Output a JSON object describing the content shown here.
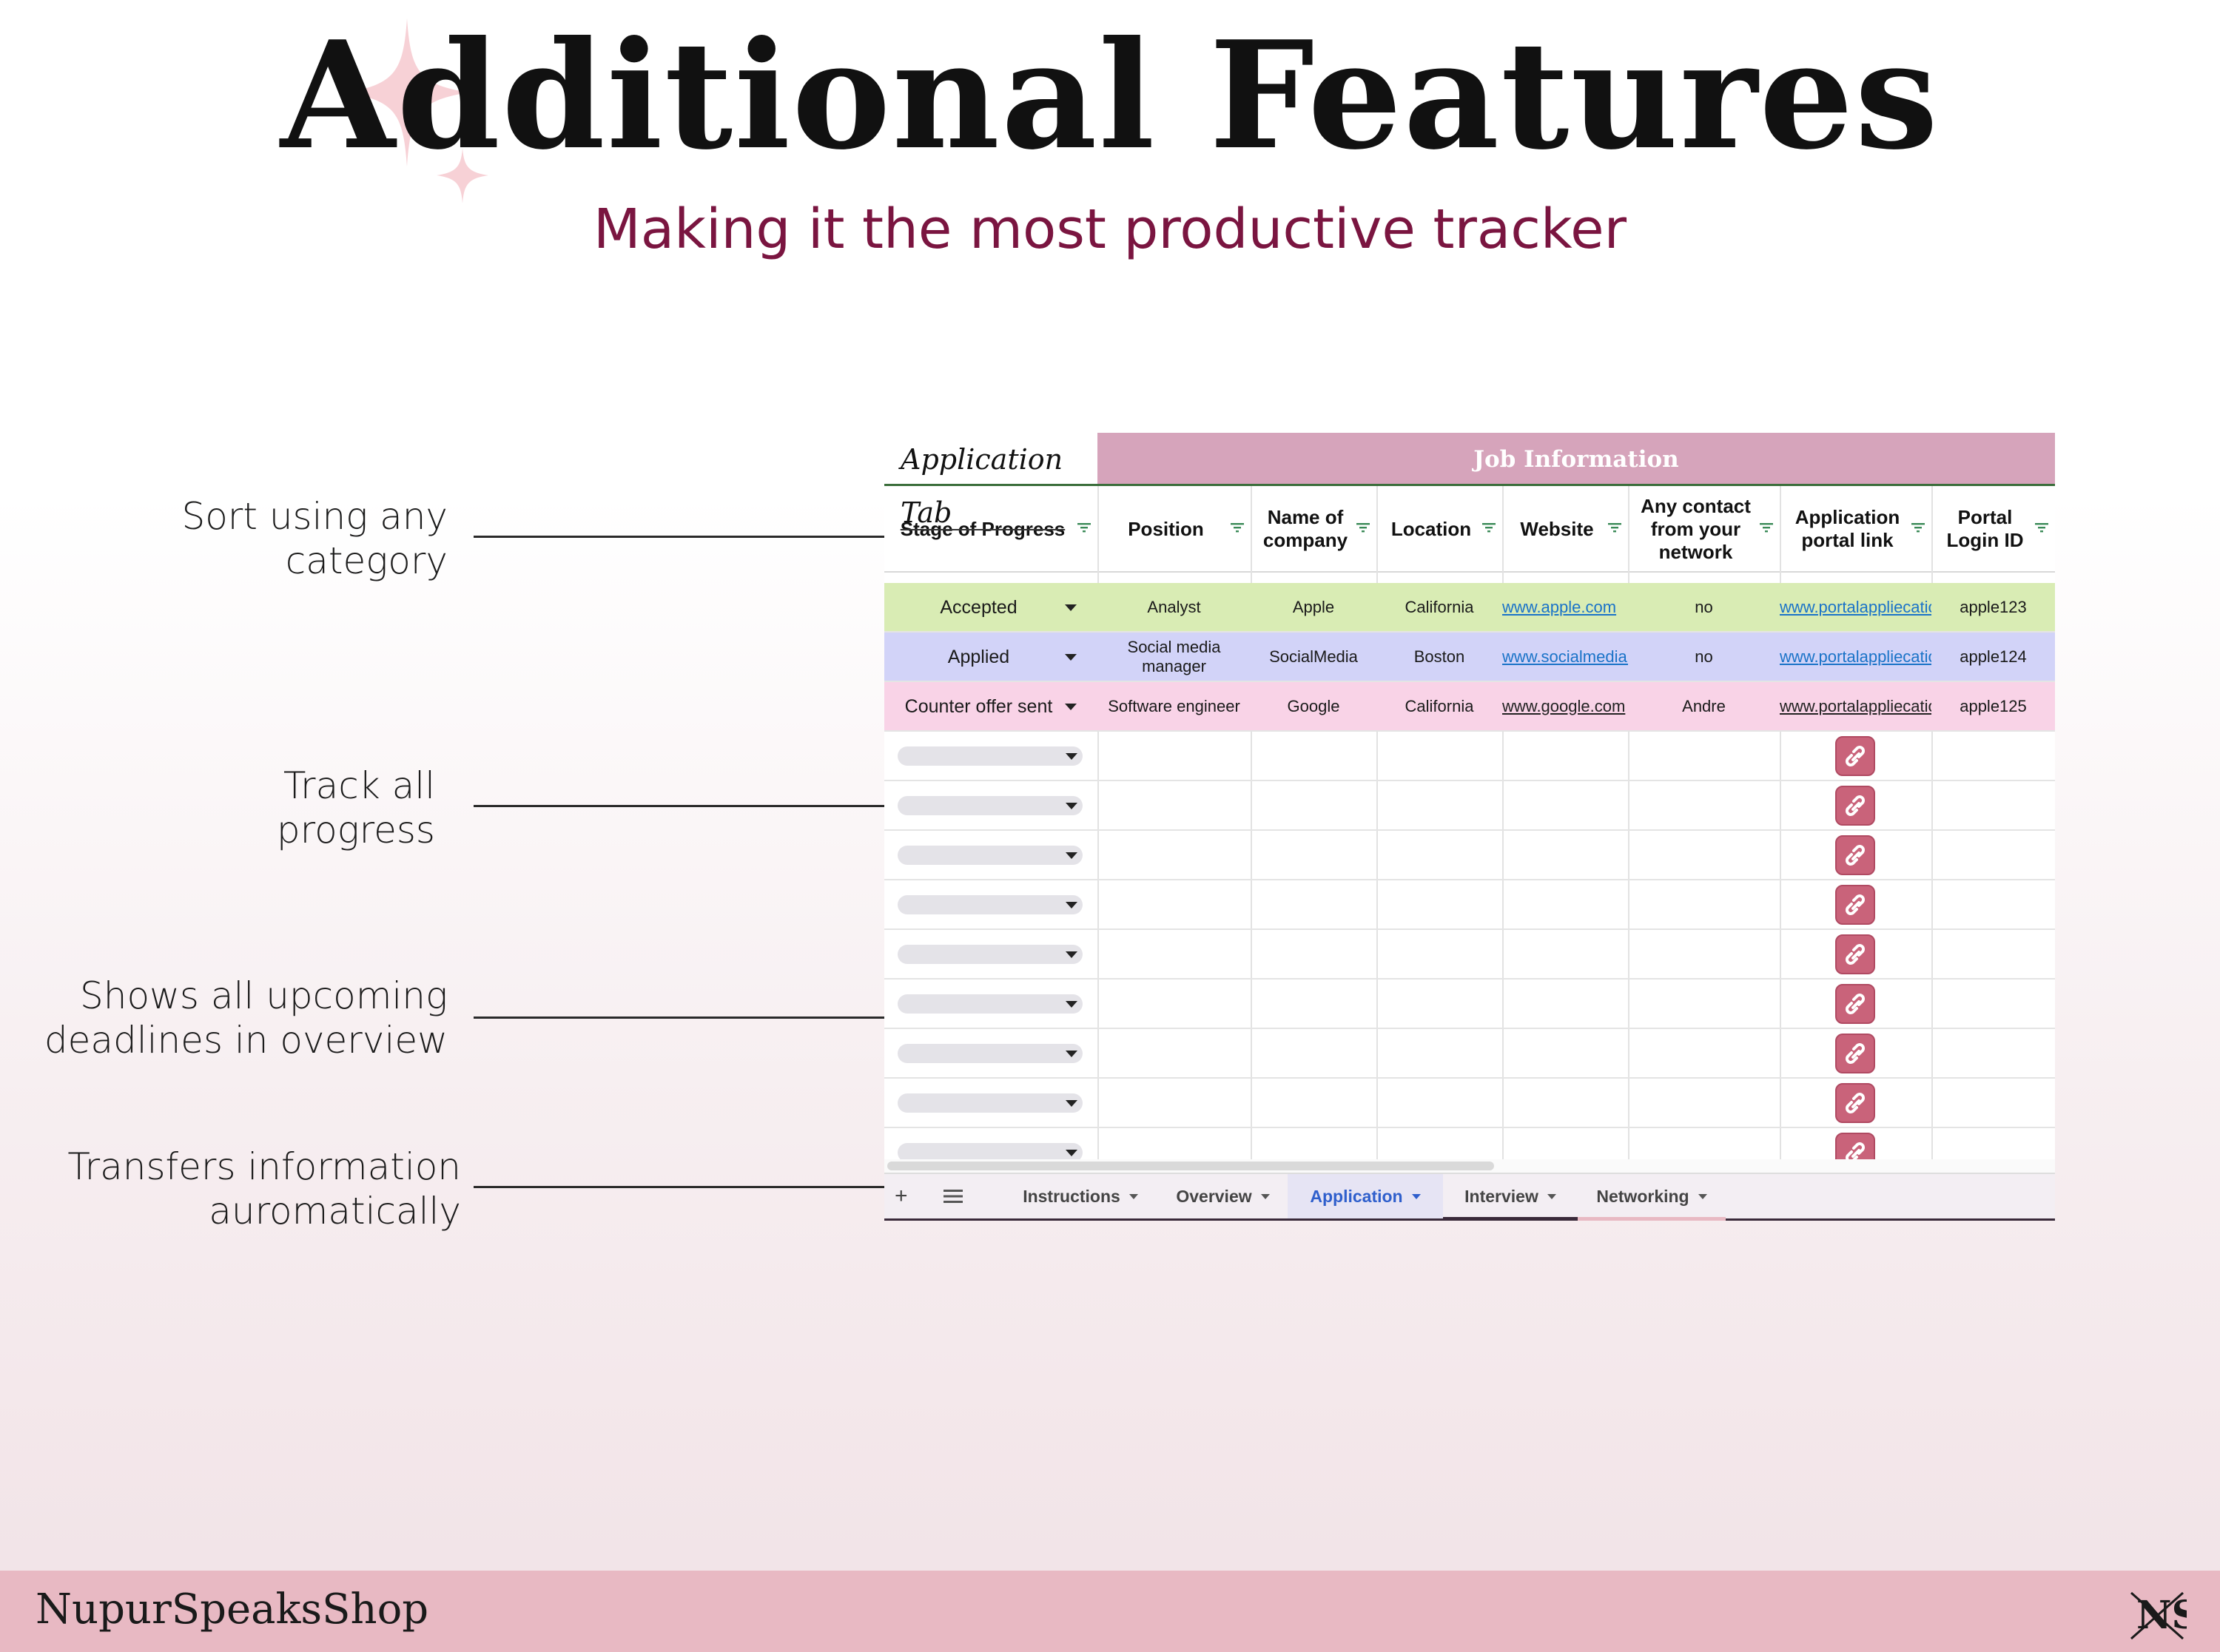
{
  "page": {
    "title": "Additional Features",
    "subtitle": "Making it the most productive tracker"
  },
  "callouts": [
    {
      "line1": "Sort using any",
      "line2": "category"
    },
    {
      "line1": "Track all",
      "line2": "progress"
    },
    {
      "line1": "Shows all upcoming",
      "line2": "deadlines in overview"
    },
    {
      "line1": "Transfers information",
      "line2": "auromatically"
    }
  ],
  "sheet": {
    "tab_title": "Application Tab",
    "section_title": "Job Information",
    "headers": [
      "Stage of Progress",
      "Position",
      "Name of company",
      "Location",
      "Website",
      "Any contact from your network",
      "Application portal link",
      "Portal Login ID"
    ],
    "rows": [
      {
        "stage": "Accepted",
        "position": "Analyst",
        "company": "Apple",
        "location": "California",
        "website": "www.apple.com",
        "contact": "no",
        "portal": "www.portalappliecation.",
        "login": "apple123",
        "color": "#d9ecb4"
      },
      {
        "stage": "Applied",
        "position": "Social media manager",
        "company": "SocialMedia",
        "location": "Boston",
        "website": "www.socialmedia.c",
        "contact": "no",
        "portal": "www.portalappliecation.",
        "login": "apple124",
        "color": "#d2d3f8"
      },
      {
        "stage": "Counter offer sent",
        "position": "Software engineer",
        "company": "Google",
        "location": "California",
        "website": "www.google.com",
        "contact": "Andre",
        "portal": "www.portalappliecation.",
        "login": "apple125",
        "color": "#f9d3e7"
      }
    ],
    "empty_rows": 9,
    "tabs": [
      "Instructions",
      "Overview",
      "Application",
      "Interview",
      "Networking"
    ],
    "active_tab": "Application",
    "icons": {
      "add": "plus-icon",
      "menu": "hamburger-menu-icon",
      "link": "chain-link-icon",
      "filter": "filter-icon"
    }
  },
  "footer": {
    "brand": "NupurSpeaksShop",
    "logo": "NS"
  },
  "colors": {
    "accent": "#7a1540",
    "banner": "#d6a4bb",
    "footer": "#e8b9c3",
    "link_button": "#c9637a",
    "active_tab": "#2f5fcc"
  }
}
